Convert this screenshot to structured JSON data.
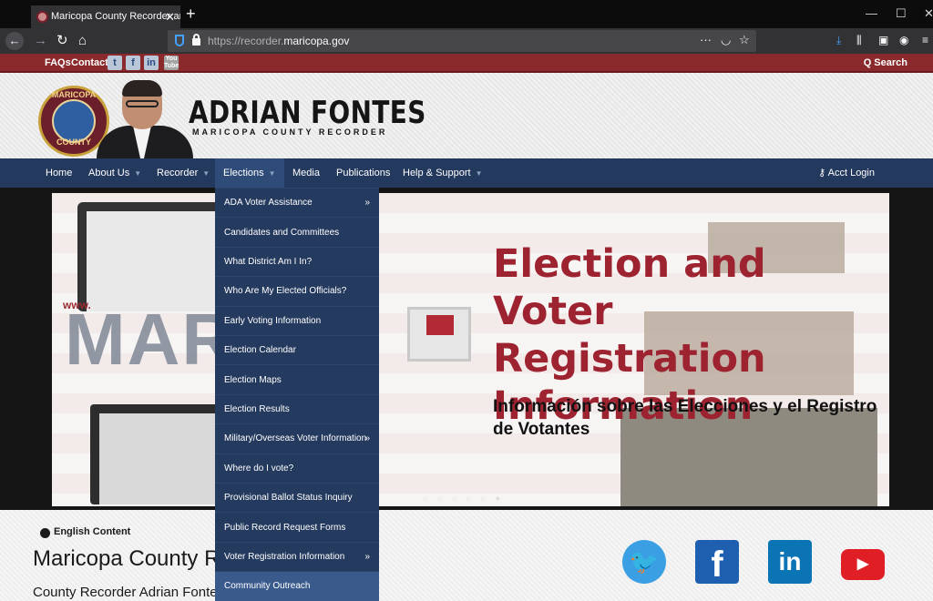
{
  "browser": {
    "tab_title": "Maricopa County Recorder and",
    "tab_close": "✕",
    "new_tab": "+",
    "url_prefix": "https://recorder.",
    "url_domain": "maricopa.gov",
    "url_menu": "···",
    "window_controls": {
      "minimize": "—",
      "maximize": "☐",
      "close": "✕"
    }
  },
  "topbar": {
    "faqs": "FAQs",
    "contact": "Contact",
    "social_small": [
      {
        "label": "t",
        "icon": "twitter-icon"
      },
      {
        "label": "f",
        "icon": "facebook-icon"
      },
      {
        "label": "in",
        "icon": "linkedin-icon"
      },
      {
        "label": "You Tube",
        "icon": "youtube-icon"
      }
    ],
    "search": "Q Search"
  },
  "header": {
    "seal_top": "MARICOPA",
    "seal_bottom": "COUNTY",
    "name": "ADRIAN FONTES",
    "subtitle": "MARICOPA COUNTY RECORDER"
  },
  "nav": {
    "items": [
      {
        "label": "Home",
        "has_dropdown": false
      },
      {
        "label": "About Us",
        "has_dropdown": true
      },
      {
        "label": "Recorder",
        "has_dropdown": true
      },
      {
        "label": "Elections",
        "has_dropdown": true
      },
      {
        "label": "Media",
        "has_dropdown": false
      },
      {
        "label": "Publications",
        "has_dropdown": false
      },
      {
        "label": "Help & Support",
        "has_dropdown": true
      }
    ],
    "acct_login": "Acct Login"
  },
  "dropdown": {
    "items": [
      {
        "label": "ADA Voter Assistance",
        "submenu": true
      },
      {
        "label": "Candidates and Committees",
        "submenu": false
      },
      {
        "label": "What District Am I In?",
        "submenu": false
      },
      {
        "label": "Who Are My Elected Officials?",
        "submenu": false
      },
      {
        "label": "Early Voting Information",
        "submenu": false
      },
      {
        "label": "Election Calendar",
        "submenu": false
      },
      {
        "label": "Election Maps",
        "submenu": false
      },
      {
        "label": "Election Results",
        "submenu": false
      },
      {
        "label": "Military/Overseas Voter Information",
        "submenu": true
      },
      {
        "label": "Where do I vote?",
        "submenu": false
      },
      {
        "label": "Provisional Ballot Status Inquiry",
        "submenu": false
      },
      {
        "label": "Public Record Request Forms",
        "submenu": false
      },
      {
        "label": "Voter Registration Information",
        "submenu": true
      },
      {
        "label": "Community Outreach",
        "submenu": false
      }
    ],
    "active_index": 13
  },
  "slide": {
    "title": "Election and Voter Registration Information",
    "subtitle": "Información sobre las Elecciones y el Registro de Votantes",
    "bg_word": "MARICO",
    "www": "www.",
    "dots": "○ ○ ○ ○ ○ ●"
  },
  "content": {
    "language": "English Content",
    "heading": "Maricopa County Re",
    "subheading": "County Recorder Adrian Fontes"
  },
  "social_large": [
    {
      "label": "🐦",
      "icon": "twitter-icon"
    },
    {
      "label": "f",
      "icon": "facebook-icon"
    },
    {
      "label": "in",
      "icon": "linkedin-icon"
    },
    {
      "label": "▶",
      "icon": "youtube-icon"
    }
  ],
  "colors": {
    "topbar": "#8a2a2c",
    "nav": "#23395d",
    "dropdown": "#243a5e",
    "title_red": "#9e2331"
  }
}
